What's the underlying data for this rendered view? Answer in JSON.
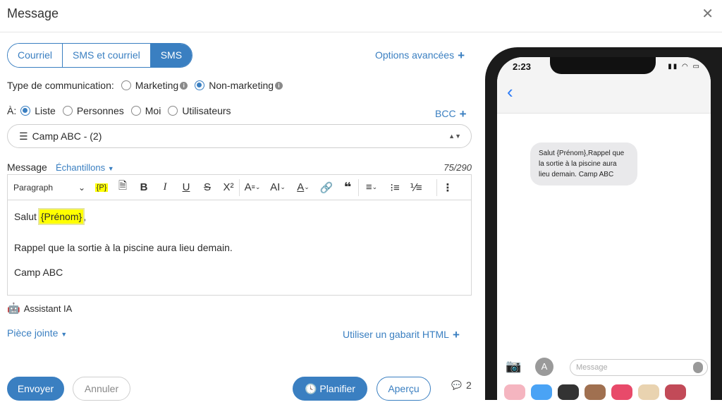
{
  "header": {
    "title": "Message",
    "close_icon": "close-icon"
  },
  "tabs": [
    {
      "label": "Courriel",
      "active": false
    },
    {
      "label": "SMS et courriel",
      "active": false
    },
    {
      "label": "SMS",
      "active": true
    }
  ],
  "advanced_options": "Options avancées",
  "comm_type": {
    "label": "Type de communication:",
    "options": [
      {
        "label": "Marketing",
        "selected": false
      },
      {
        "label": "Non-marketing",
        "selected": true
      }
    ]
  },
  "to": {
    "label": "À:",
    "options": [
      {
        "label": "Liste",
        "selected": true
      },
      {
        "label": "Personnes",
        "selected": false
      },
      {
        "label": "Moi",
        "selected": false
      },
      {
        "label": "Utilisateurs",
        "selected": false
      }
    ],
    "bcc": "BCC"
  },
  "list_select": {
    "value": "Camp ABC - (2)"
  },
  "message": {
    "label": "Message",
    "samples": "Échantillons",
    "counter": "75/290",
    "toolbar": {
      "paragraph": "Paragraph",
      "placeholder_tag": "{P}"
    },
    "body": {
      "greeting": "Salut",
      "placeholder": "{Prénom}",
      "comma": ",",
      "line2": "Rappel que la sortie à la piscine aura lieu demain.",
      "line3": "Camp ABC"
    }
  },
  "assistant": "Assistant IA",
  "attachment": "Pièce jointe",
  "html_template": "Utiliser un gabarit HTML",
  "buttons": {
    "send": "Envoyer",
    "cancel": "Annuler",
    "schedule": "Planifier",
    "preview": "Aperçu"
  },
  "sms_count": "2",
  "phone": {
    "time": "2:23",
    "bubble": "Salut {Prénom},Rappel que la sortie à la piscine aura lieu demain. Camp ABC",
    "input_placeholder": "Message"
  },
  "colors": {
    "accent": "#3a7fc1",
    "highlight": "#ffff00"
  }
}
